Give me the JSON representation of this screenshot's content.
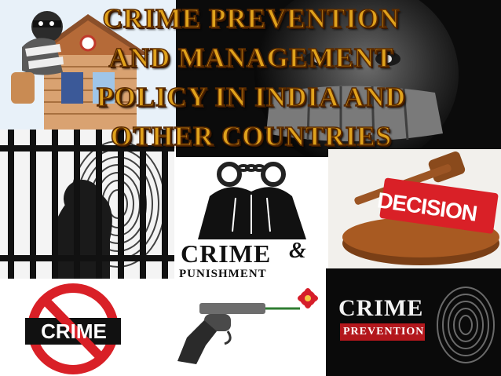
{
  "title": {
    "lines": [
      "CRIME PREVENTION",
      "AND MANAGEMENT",
      "POLICY IN INDIA AND",
      "OTHER COUNTRIES"
    ]
  },
  "tiles": {
    "crime_punishment": {
      "word1": "CRIME",
      "amp": "&",
      "word2": "PUNISHMENT"
    },
    "decision": {
      "label": "DECISION"
    },
    "crime_prevention": {
      "word1": "CRIME",
      "word2": "PREVENTION"
    },
    "crime_sign": {
      "label": "CRIME"
    }
  },
  "colors": {
    "title_fill": "#e0a21c",
    "title_outline": "#5a2a00",
    "decision_red": "#c81d25",
    "sign_red": "#d92027"
  }
}
